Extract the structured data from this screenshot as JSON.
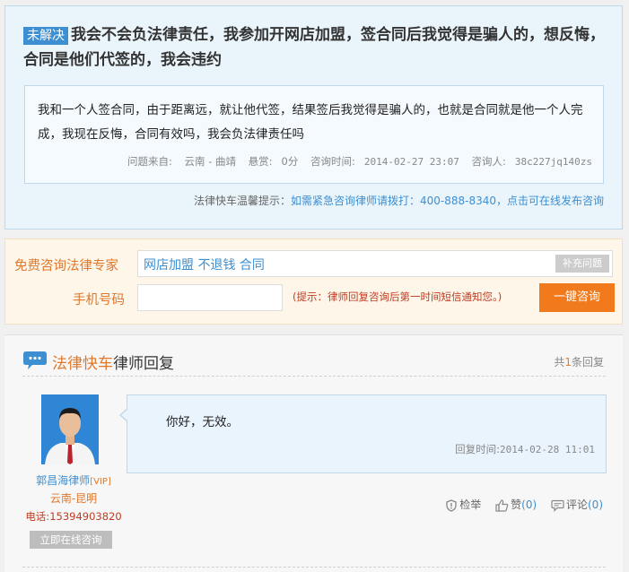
{
  "question": {
    "status": "未解决",
    "title": "我会不会负法律责任，我参加开网店加盟，签合同后我觉得是骗人的，想反悔，合同是他们代签的，我会违约",
    "body": "我和一个人签合同，由于距离远，就让他代签，结果签后我觉得是骗人的，也就是合同就是他一个人完成，我现在反悔，合同有效吗，我会负法律责任吗",
    "source_label": "问题来自:",
    "source_value": "云南 - 曲靖",
    "reward_label": "悬赏:",
    "reward_value": "0分",
    "time_label": "咨询时间:",
    "time_value": "2014-02-27 23:07",
    "asker_label": "咨询人:",
    "asker_value": "38c227jq140zs"
  },
  "tip": {
    "prefix": "法律快车温馨提示：",
    "text": "如需紧急咨询律师请拨打：400-888-8340，点击可在线发布咨询"
  },
  "consult": {
    "label1": "免费咨询法律专家",
    "input1_value": "网店加盟 不退钱 合同",
    "add_button": "补充问题",
    "label2": "手机号码",
    "input2_value": "",
    "hint": "(提示：律师回复咨询后第一时间短信通知您。)",
    "submit": "一键咨询"
  },
  "answers": {
    "title_brand": "法律快车",
    "title_rest": "律师回复",
    "count_prefix": "共",
    "count_value": "1",
    "count_suffix": "条回复"
  },
  "lawyer": {
    "name": "郭昌海律师",
    "vip": "[VIP]",
    "location": "云南-昆明",
    "tel_label": "电话:",
    "tel_value": "15394903820",
    "online_button": "立即在线咨询"
  },
  "reply": {
    "text": "你好，无效。",
    "time_label": "回复时间:",
    "time_value": "2014-02-28 11:01"
  },
  "actions": {
    "report": "检举",
    "like": "赞",
    "like_count": "(0)",
    "comment": "评论",
    "comment_count": "(0)"
  },
  "colors": {
    "brand_blue": "#3d8fd1",
    "brand_orange": "#f17a1c"
  }
}
